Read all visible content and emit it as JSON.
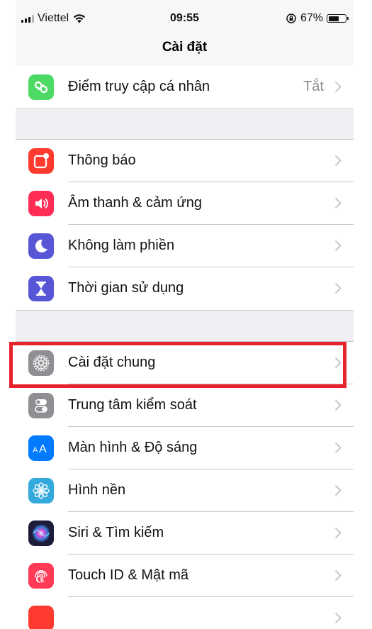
{
  "status_bar": {
    "carrier": "Viettel",
    "time": "09:55",
    "battery_percent": "67%",
    "battery_level": 0.67
  },
  "nav": {
    "title": "Cài đặt"
  },
  "groups": [
    {
      "items": [
        {
          "label": "Điểm truy cập cá nhân",
          "value": "Tắt",
          "icon": "personal-hotspot-icon",
          "color": "#4cd964"
        }
      ]
    },
    {
      "items": [
        {
          "label": "Thông báo",
          "icon": "notifications-icon",
          "color": "#ff3b30"
        },
        {
          "label": "Âm thanh & cảm ứng",
          "icon": "sounds-icon",
          "color": "#ff2d55"
        },
        {
          "label": "Không làm phiền",
          "icon": "moon-icon",
          "color": "#5856d6"
        },
        {
          "label": "Thời gian sử dụng",
          "icon": "hourglass-icon",
          "color": "#5856d6"
        }
      ]
    },
    {
      "items": [
        {
          "label": "Cài đặt chung",
          "icon": "gear-icon",
          "color": "#8e8e93"
        },
        {
          "label": "Trung tâm kiểm soát",
          "icon": "toggles-icon",
          "color": "#8e8e93"
        },
        {
          "label": "Màn hình & Độ sáng",
          "icon": "display-brightness-icon",
          "color": "#007aff"
        },
        {
          "label": "Hình nền",
          "icon": "wallpaper-flower-icon",
          "color": "#34aadc"
        },
        {
          "label": "Siri & Tìm kiếm",
          "icon": "siri-icon",
          "color": "#1c1c3a"
        },
        {
          "label": "Touch ID & Mật mã",
          "icon": "fingerprint-icon",
          "color": "#ff3b55"
        },
        {
          "label": "",
          "icon": "sos-icon",
          "color": "#ff3b30"
        }
      ]
    }
  ],
  "highlight_color": "#e8222c"
}
